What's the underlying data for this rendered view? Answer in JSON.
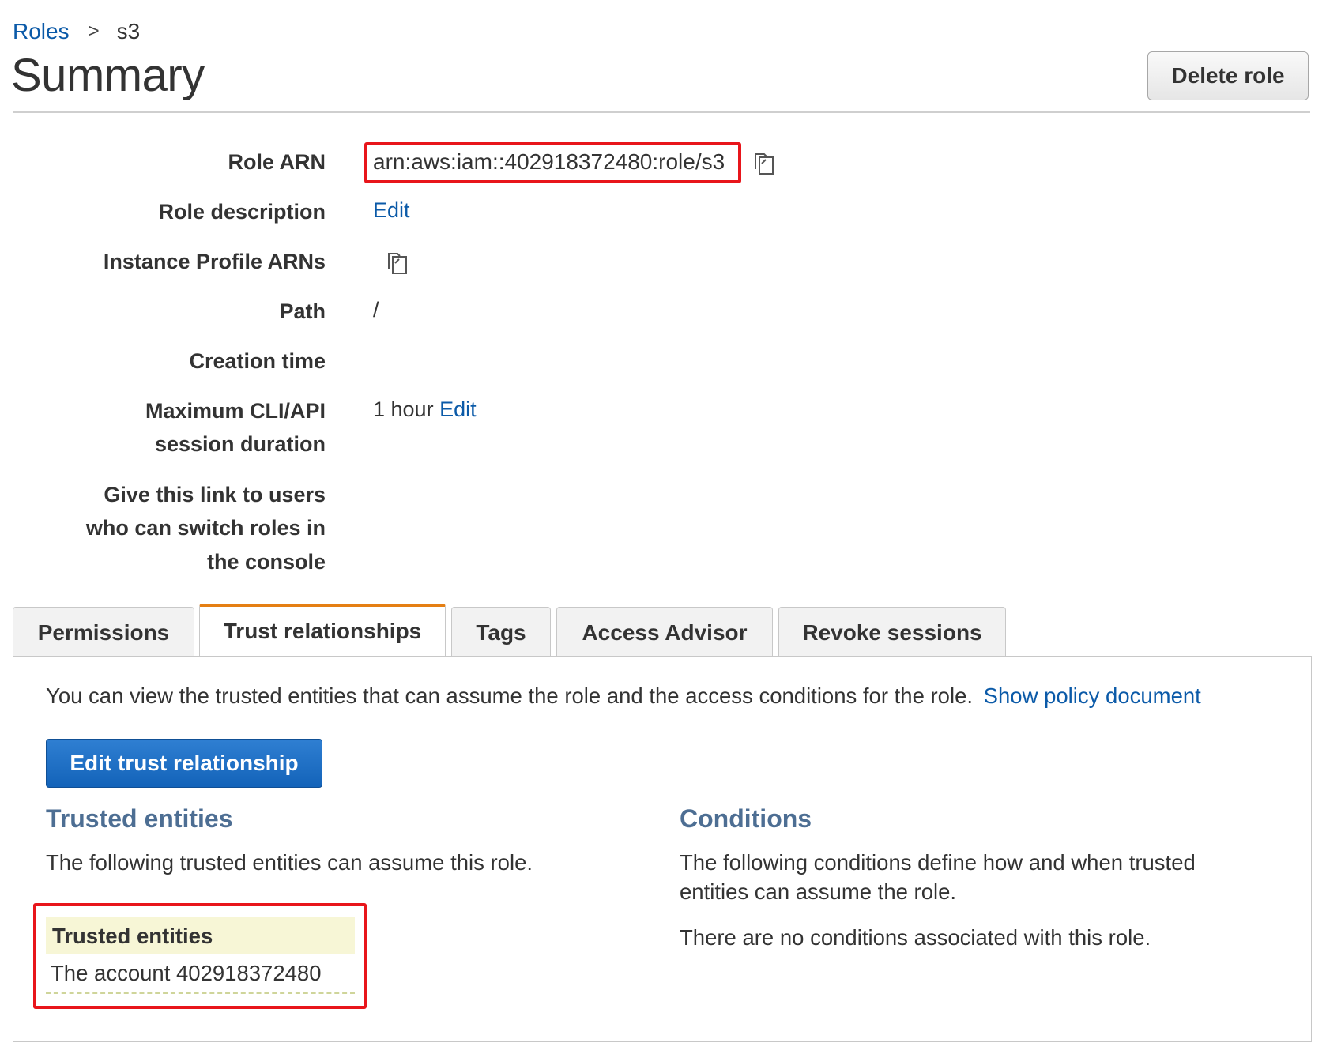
{
  "breadcrumb": {
    "root": "Roles",
    "separator": ">",
    "current": "s3"
  },
  "page": {
    "title": "Summary",
    "delete_button": "Delete role"
  },
  "summary": {
    "role_arn": {
      "label": "Role ARN",
      "value": "arn:aws:iam::402918372480:role/s3"
    },
    "role_description": {
      "label": "Role description",
      "link": "Edit"
    },
    "instance_profile_arns": {
      "label": "Instance Profile ARNs"
    },
    "path": {
      "label": "Path",
      "value": "/"
    },
    "creation_time": {
      "label": "Creation time",
      "value": ""
    },
    "max_session": {
      "label_line1": "Maximum CLI/API",
      "label_line2": "session duration",
      "value": "1 hour",
      "link": "Edit"
    },
    "switch_link": {
      "label_line1": "Give this link to users",
      "label_line2": "who can switch roles in",
      "label_line3": "the console"
    }
  },
  "tabs": [
    {
      "label": "Permissions",
      "active": false
    },
    {
      "label": "Trust relationships",
      "active": true
    },
    {
      "label": "Tags",
      "active": false
    },
    {
      "label": "Access Advisor",
      "active": false
    },
    {
      "label": "Revoke sessions",
      "active": false
    }
  ],
  "trust": {
    "intro": "You can view the trusted entities that can assume the role and the access conditions for the role.",
    "show_policy_link": "Show policy document",
    "edit_button": "Edit trust relationship",
    "entities_heading": "Trusted entities",
    "entities_desc": "The following trusted entities can assume this role.",
    "table_header": "Trusted entities",
    "table_rows": [
      "The account 402918372480"
    ],
    "conditions_heading": "Conditions",
    "conditions_desc_line1": "The following conditions define how and when trusted",
    "conditions_desc_line2": "entities can assume the role.",
    "no_conditions": "There are no conditions associated with this role."
  },
  "colors": {
    "link": "#0b5aa8",
    "highlight_border": "#e8151b",
    "active_tab_accent": "#e57f13",
    "primary_button": "#1f6fc5",
    "section_heading": "#4d6e93",
    "table_header_bg": "#f7f6d6"
  },
  "icons": [
    "copy-icon"
  ]
}
